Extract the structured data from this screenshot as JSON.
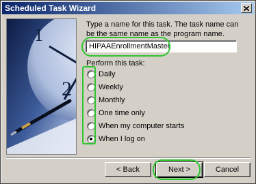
{
  "window": {
    "title": "Scheduled Task Wizard"
  },
  "instructions": "Type a name for this task.  The task name can be the same name as the program name.",
  "task_name": {
    "value": "HIPAAEnrollmentMaster"
  },
  "perform": {
    "label": "Perform this task:",
    "options": [
      {
        "label": "Daily",
        "checked": false
      },
      {
        "label": "Weekly",
        "checked": false
      },
      {
        "label": "Monthly",
        "checked": false
      },
      {
        "label": "One time only",
        "checked": false
      },
      {
        "label": "When my computer starts",
        "checked": false
      },
      {
        "label": "When I log on",
        "checked": true
      }
    ]
  },
  "buttons": {
    "back": "< Back",
    "next": "Next >",
    "cancel": "Cancel"
  },
  "colors": {
    "highlight": "#2fc52f",
    "titlebar": "#0a246a"
  },
  "icons": {
    "close": "close-icon",
    "artwork": "clock-pen-illustration"
  }
}
